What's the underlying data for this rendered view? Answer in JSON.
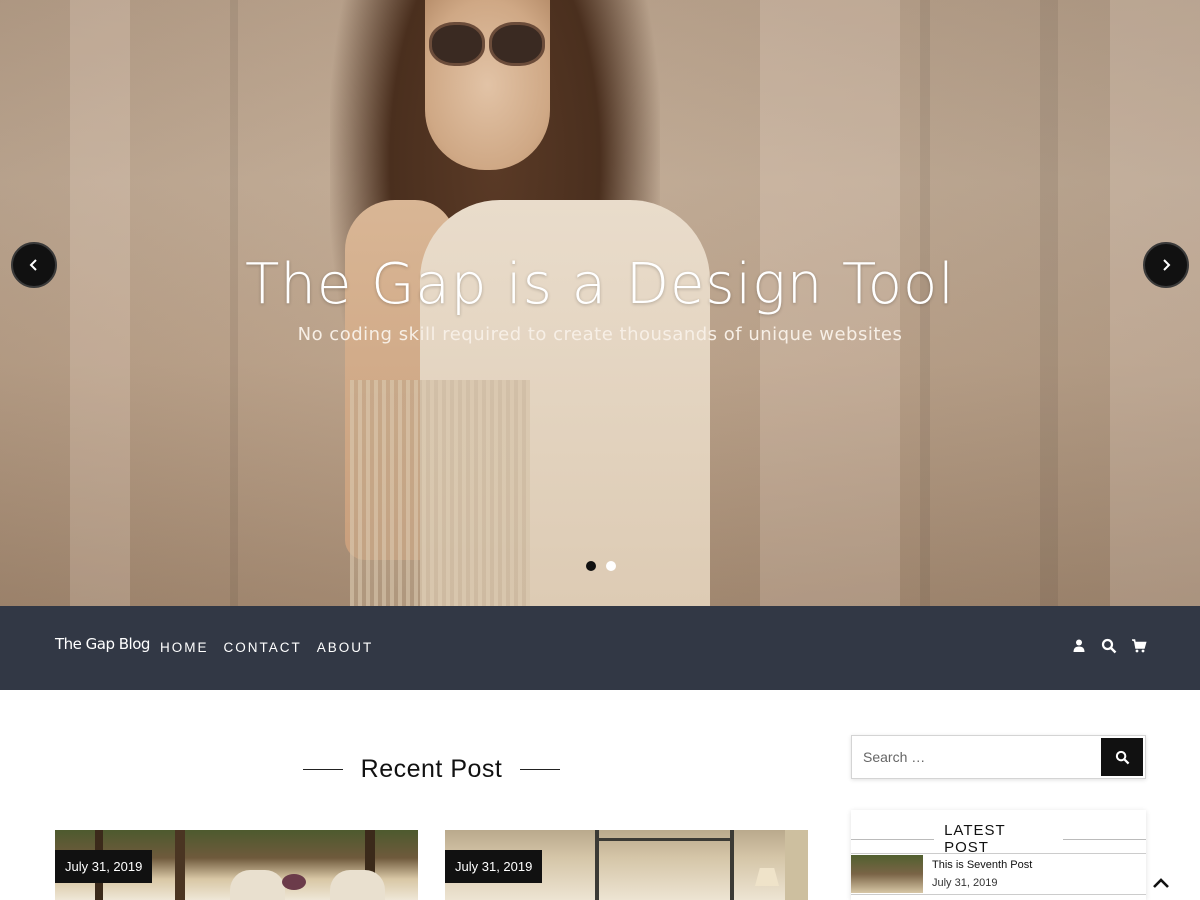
{
  "hero": {
    "title": "The Gap is a Design Tool",
    "subtitle": "No coding skill required to create thousands of unique websites",
    "prev_icon": "chevron-left-icon",
    "next_icon": "chevron-right-icon",
    "slides_count": 2,
    "active_slide": 1
  },
  "nav": {
    "logo": "The Gap Blog",
    "links": [
      "HOME",
      "CONTACT",
      "ABOUT"
    ],
    "icons": [
      "user-icon",
      "search-icon",
      "cart-icon"
    ],
    "background": "#323845"
  },
  "main": {
    "section_title": "Recent Post",
    "posts": [
      {
        "date": "July 31, 2019"
      },
      {
        "date": "July 31, 2019"
      }
    ]
  },
  "sidebar": {
    "search": {
      "placeholder": "Search …",
      "button_icon": "search-icon"
    },
    "latest": {
      "title": "LATEST POST",
      "items": [
        {
          "title": "This is Seventh Post",
          "date": "July 31, 2019"
        }
      ]
    }
  },
  "scroll_top_icon": "chevron-up-icon"
}
